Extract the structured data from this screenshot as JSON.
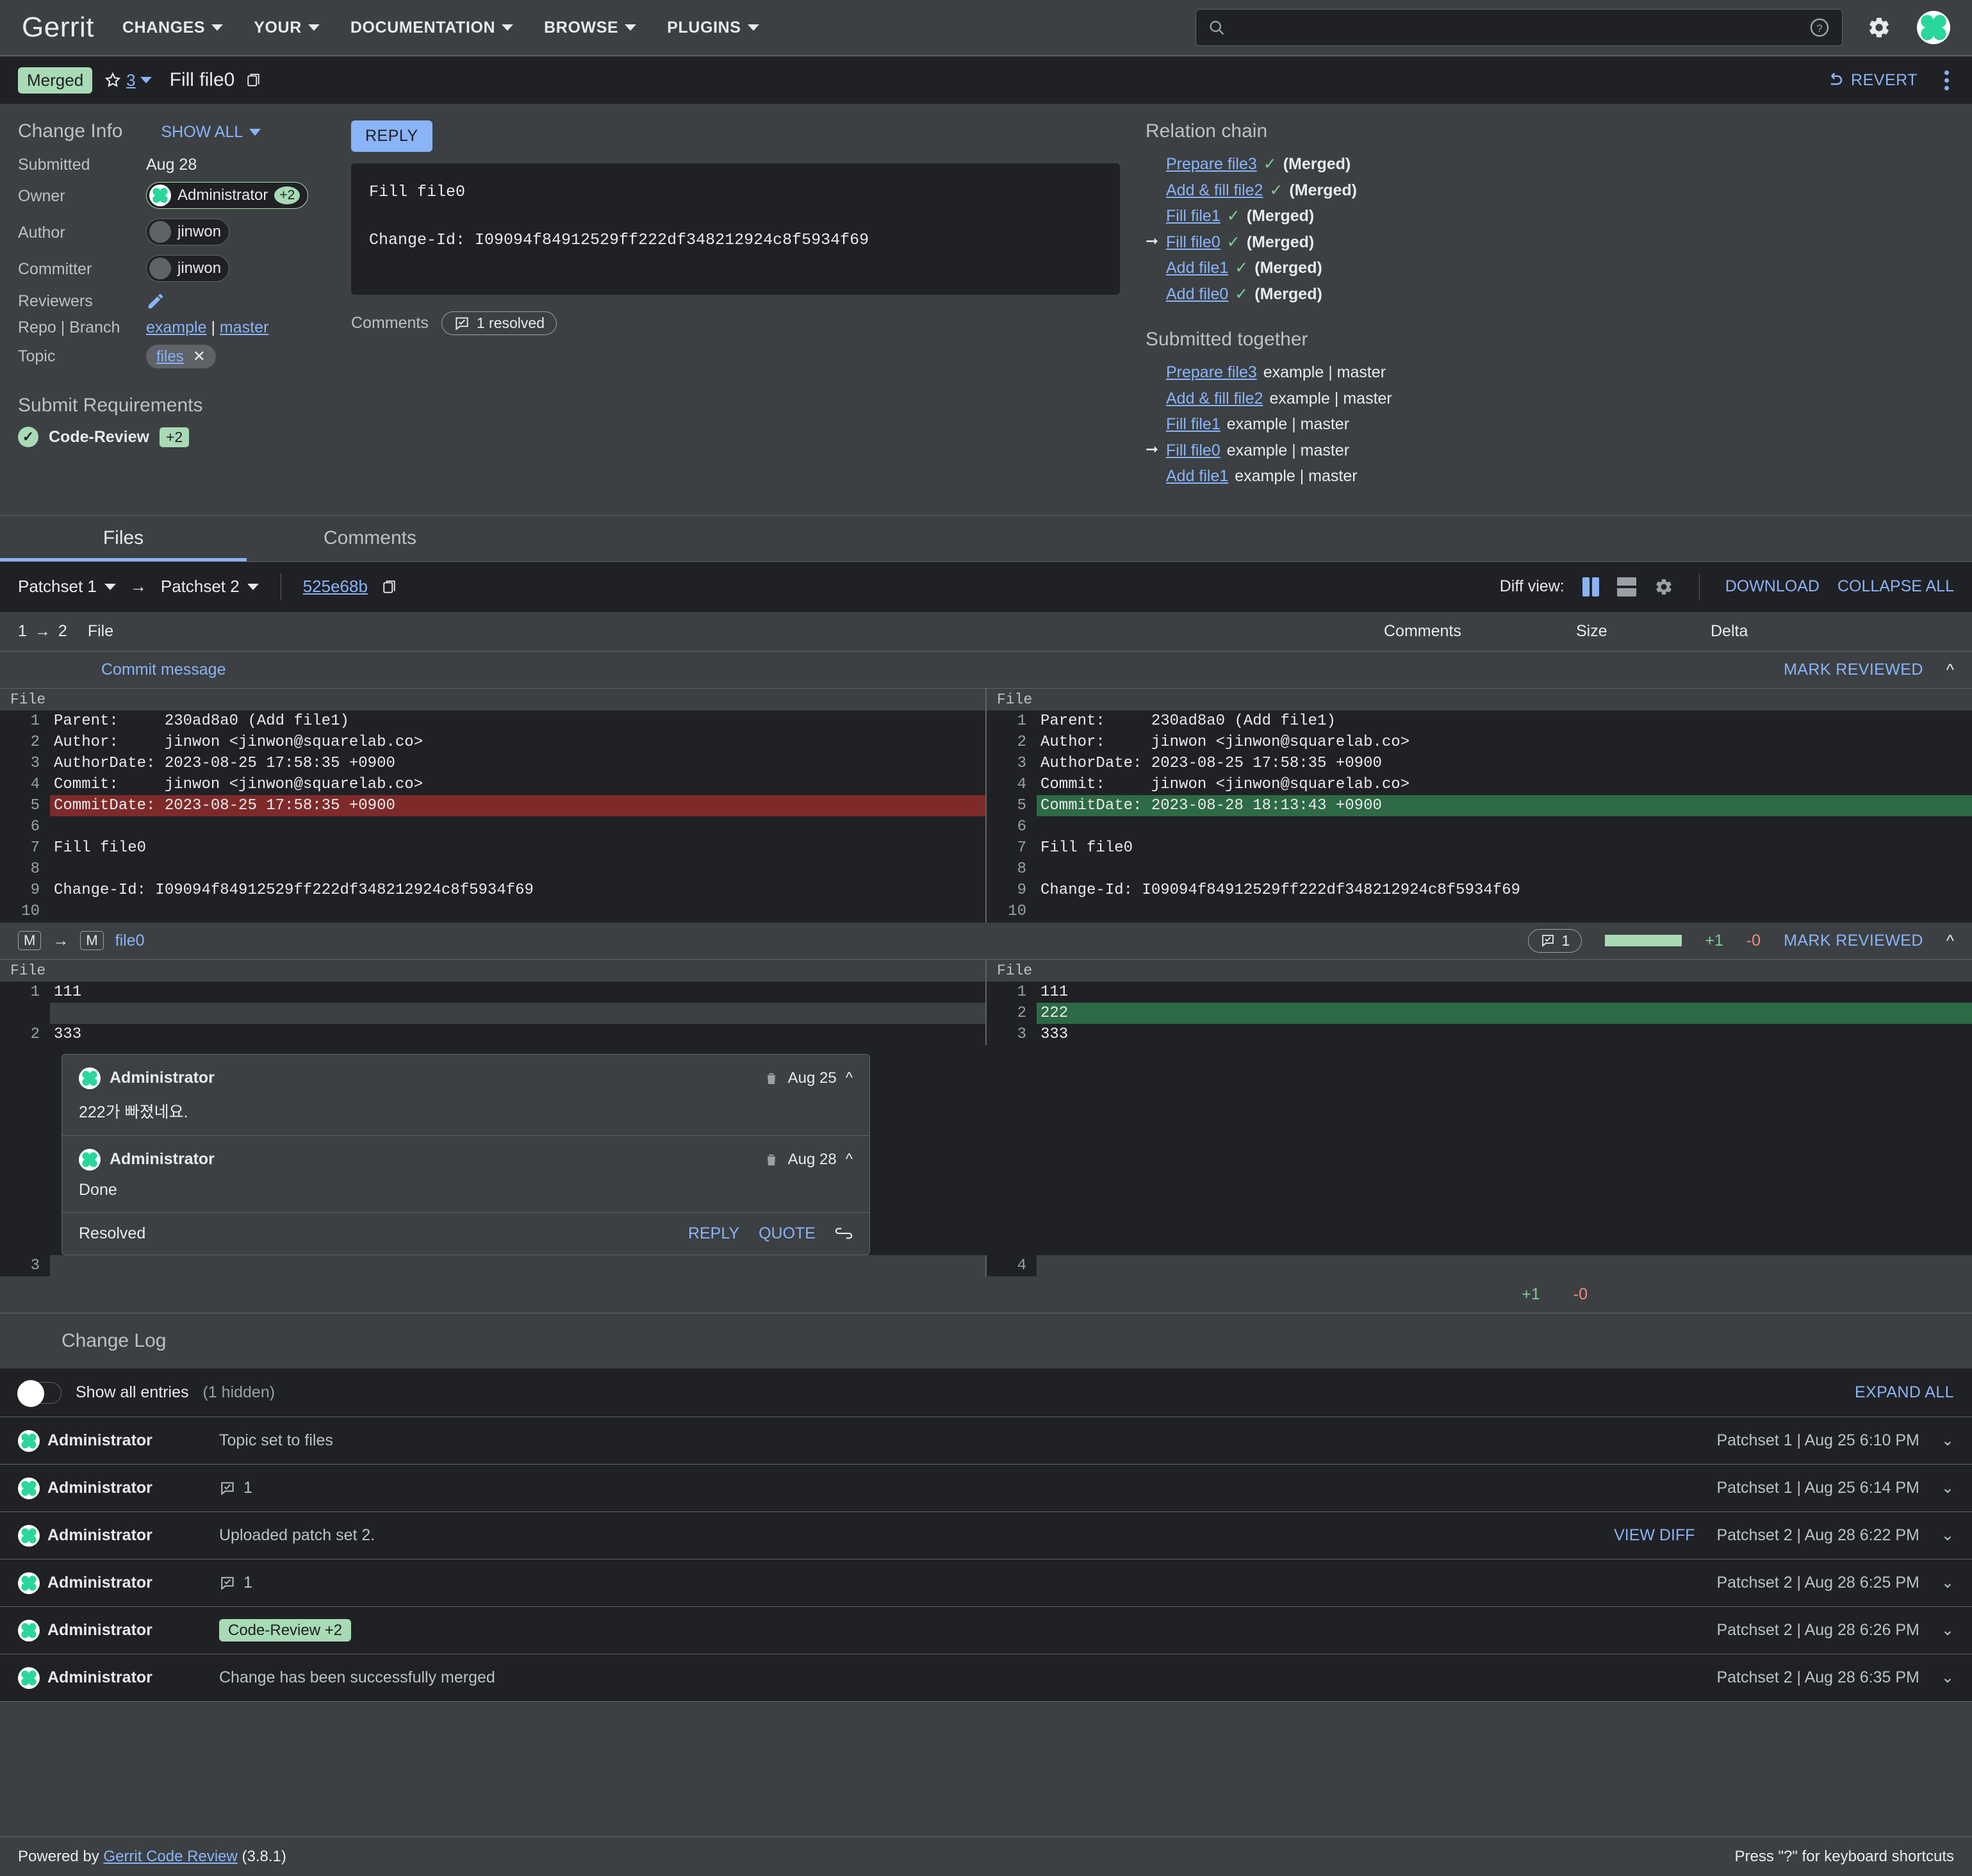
{
  "header": {
    "logo": "Gerrit",
    "nav": [
      {
        "label": "CHANGES"
      },
      {
        "label": "YOUR"
      },
      {
        "label": "DOCUMENTATION"
      },
      {
        "label": "BROWSE"
      },
      {
        "label": "PLUGINS"
      }
    ],
    "search_placeholder": "",
    "help_icon": "help-circle-icon",
    "settings_icon": "gear-icon",
    "account_icon": "account-avatar"
  },
  "change_bar": {
    "status": "Merged",
    "star_count": "3",
    "title": "Fill file0",
    "copy_icon": "copy-icon",
    "revert_label": "REVERT",
    "overflow_icon": "more-vert-icon"
  },
  "change_info": {
    "heading": "Change Info",
    "show_all": "SHOW ALL",
    "rows": [
      {
        "key": "Submitted",
        "value": "Aug 28",
        "type": "text"
      },
      {
        "key": "Owner",
        "value": "Administrator",
        "type": "chip-owner",
        "vote": "+2"
      },
      {
        "key": "Author",
        "value": "jinwon",
        "type": "chip"
      },
      {
        "key": "Committer",
        "value": "jinwon",
        "type": "chip"
      },
      {
        "key": "Reviewers",
        "value": "",
        "type": "edit"
      },
      {
        "key": "Repo | Branch",
        "value": "example | master",
        "type": "links",
        "repo": "example",
        "branch": "master"
      },
      {
        "key": "Topic",
        "value": "files",
        "type": "topic"
      }
    ]
  },
  "submit_requirements": {
    "heading": "Submit Requirements",
    "items": [
      {
        "label": "Code-Review",
        "vote": "+2",
        "status": "satisfied"
      }
    ]
  },
  "commit": {
    "reply_label": "REPLY",
    "message_line1": "Fill file0",
    "message_line2": "Change-Id: I09094f84912529ff222df348212924c8f5934f69",
    "comments_label": "Comments",
    "comments_pill": "1 resolved"
  },
  "relation_chain": {
    "heading": "Relation chain",
    "items": [
      {
        "title": "Prepare file3",
        "status": "(Merged)",
        "current": false
      },
      {
        "title": "Add & fill file2",
        "status": "(Merged)",
        "current": false
      },
      {
        "title": "Fill file1",
        "status": "(Merged)",
        "current": false
      },
      {
        "title": "Fill file0",
        "status": "(Merged)",
        "current": true
      },
      {
        "title": "Add file1",
        "status": "(Merged)",
        "current": false
      },
      {
        "title": "Add file0",
        "status": "(Merged)",
        "current": false
      }
    ]
  },
  "submitted_together": {
    "heading": "Submitted together",
    "items": [
      {
        "title": "Prepare file3",
        "target": "example | master",
        "current": false
      },
      {
        "title": "Add & fill file2",
        "target": "example | master",
        "current": false
      },
      {
        "title": "Fill file1",
        "target": "example | master",
        "current": false
      },
      {
        "title": "Fill file0",
        "target": "example | master",
        "current": true
      },
      {
        "title": "Add file1",
        "target": "example | master",
        "current": false
      }
    ]
  },
  "tabs": [
    {
      "label": "Files",
      "active": true
    },
    {
      "label": "Comments",
      "active": false
    }
  ],
  "patchset_bar": {
    "left_patchset": "Patchset 1",
    "right_patchset": "Patchset 2",
    "revision": "525e68b",
    "copy_icon": "copy-icon",
    "diff_view_label": "Diff view:",
    "side_by_side_icon": "side-by-side-icon",
    "unified_icon": "unified-view-icon",
    "prefs_icon": "gear-icon",
    "download": "DOWNLOAD",
    "collapse_all": "COLLAPSE ALL"
  },
  "file_table": {
    "count_from": "1",
    "count_to": "2",
    "col_file": "File",
    "col_comments": "Comments",
    "col_size": "Size",
    "col_delta": "Delta",
    "commit_message_row": {
      "name": "Commit message",
      "mark_reviewed": "MARK REVIEWED"
    },
    "file0_row": {
      "badge_old": "M",
      "badge_new": "M",
      "name": "file0",
      "comment_count": "1",
      "added": "+1",
      "removed": "-0",
      "mark_reviewed": "MARK REVIEWED"
    },
    "totals": {
      "added": "+1",
      "removed": "-0"
    }
  },
  "commit_diff": {
    "file_label": "File",
    "left": [
      {
        "n": "1",
        "text": "Parent:     230ad8a0 (Add file1)",
        "type": "ctx"
      },
      {
        "n": "2",
        "text": "Author:     jinwon <jinwon@squarelab.co>",
        "type": "ctx"
      },
      {
        "n": "3",
        "text": "AuthorDate: 2023-08-25 17:58:35 +0900",
        "type": "ctx"
      },
      {
        "n": "4",
        "text": "Commit:     jinwon <jinwon@squarelab.co>",
        "type": "ctx"
      },
      {
        "n": "5",
        "text": "CommitDate: 2023-08-25 17:58:35 +0900",
        "type": "del"
      },
      {
        "n": "6",
        "text": "",
        "type": "ctx"
      },
      {
        "n": "7",
        "text": "Fill file0",
        "type": "ctx"
      },
      {
        "n": "8",
        "text": "",
        "type": "ctx"
      },
      {
        "n": "9",
        "text": "Change-Id: I09094f84912529ff222df348212924c8f5934f69",
        "type": "ctx"
      },
      {
        "n": "10",
        "text": "",
        "type": "ctx"
      }
    ],
    "right": [
      {
        "n": "1",
        "text": "Parent:     230ad8a0 (Add file1)",
        "type": "ctx"
      },
      {
        "n": "2",
        "text": "Author:     jinwon <jinwon@squarelab.co>",
        "type": "ctx"
      },
      {
        "n": "3",
        "text": "AuthorDate: 2023-08-25 17:58:35 +0900",
        "type": "ctx"
      },
      {
        "n": "4",
        "text": "Commit:     jinwon <jinwon@squarelab.co>",
        "type": "ctx"
      },
      {
        "n": "5",
        "text": "CommitDate: 2023-08-28 18:13:43 +0900",
        "type": "add"
      },
      {
        "n": "6",
        "text": "",
        "type": "ctx"
      },
      {
        "n": "7",
        "text": "Fill file0",
        "type": "ctx"
      },
      {
        "n": "8",
        "text": "",
        "type": "ctx"
      },
      {
        "n": "9",
        "text": "Change-Id: I09094f84912529ff222df348212924c8f5934f69",
        "type": "ctx"
      },
      {
        "n": "10",
        "text": "",
        "type": "ctx"
      }
    ]
  },
  "file0_diff": {
    "file_label": "File",
    "left": [
      {
        "n": "1",
        "text": "111",
        "type": "ctx"
      },
      {
        "n": "",
        "text": "",
        "type": "blank"
      },
      {
        "n": "2",
        "text": "333",
        "type": "ctx"
      }
    ],
    "right": [
      {
        "n": "1",
        "text": "111",
        "type": "ctx"
      },
      {
        "n": "2",
        "text": "222",
        "type": "add"
      },
      {
        "n": "3",
        "text": "333",
        "type": "ctx"
      }
    ],
    "tail_left_line": "3",
    "tail_right_line": "4"
  },
  "comment_thread": {
    "comments": [
      {
        "author": "Administrator",
        "date": "Aug 25",
        "body": "222가 빠졌네요."
      },
      {
        "author": "Administrator",
        "date": "Aug 28",
        "body": "Done"
      }
    ],
    "status": "Resolved",
    "reply": "REPLY",
    "quote": "QUOTE",
    "link_icon": "link-icon",
    "delete_icon": "trash-icon",
    "collapse_icon": "chevron-up-icon"
  },
  "change_log": {
    "heading": "Change Log",
    "show_all_entries": "Show all entries",
    "hidden_note": "(1 hidden)",
    "expand_all": "EXPAND ALL",
    "entries": [
      {
        "author": "Administrator",
        "message": "Topic set to files",
        "kind": "text",
        "action": "",
        "meta": "Patchset 1 | Aug 25 6:10 PM"
      },
      {
        "author": "Administrator",
        "message": "1",
        "kind": "comment",
        "action": "",
        "meta": "Patchset 1 | Aug 25 6:14 PM"
      },
      {
        "author": "Administrator",
        "message": "Uploaded patch set 2.",
        "kind": "text",
        "action": "VIEW DIFF",
        "meta": "Patchset 2 | Aug 28 6:22 PM"
      },
      {
        "author": "Administrator",
        "message": "1",
        "kind": "comment",
        "action": "",
        "meta": "Patchset 2 | Aug 28 6:25 PM"
      },
      {
        "author": "Administrator",
        "message": "Code-Review +2",
        "kind": "vote",
        "action": "",
        "meta": "Patchset 2 | Aug 28 6:26 PM"
      },
      {
        "author": "Administrator",
        "message": "Change has been successfully merged",
        "kind": "text",
        "action": "",
        "meta": "Patchset 2 | Aug 28 6:35 PM"
      }
    ]
  },
  "footer": {
    "powered_prefix": "Powered by",
    "link": "Gerrit Code Review",
    "version": "(3.8.1)",
    "shortcut_hint": "Press \"?\" for keyboard shortcuts"
  },
  "colors": {
    "accent": "#8ab4f8",
    "merged_green": "#a8dab5",
    "add_green": "#2d6a45",
    "del_red": "#7e2a2a",
    "bg_dark": "#202124",
    "bg_panel": "#3c4043"
  }
}
